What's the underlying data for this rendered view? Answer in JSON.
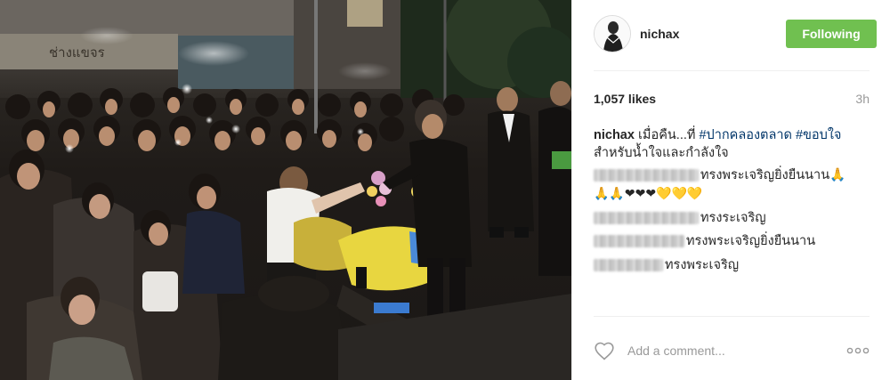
{
  "post": {
    "username": "nichax",
    "follow_label": "Following",
    "likes": "1,057 likes",
    "time": "3h",
    "caption": {
      "user": "nichax",
      "text_before": "เมื่อคืน...ที่",
      "hashtag1": "#ปากคลองตลาด",
      "hashtag2": "#ขอบใจ",
      "text_after": "สำหรับน้ำใจและกำลังใจ"
    },
    "comments": [
      {
        "text": "ทรงพระเจริญยิ่งยืนนาน🙏",
        "extra": "🙏🙏❤❤❤💛💛💛"
      },
      {
        "text": "ทรงระเจริญ"
      },
      {
        "text": "ทรงพระเจริญยิ่งยืนนาน"
      },
      {
        "text": "ทรงพระเจริญ"
      }
    ],
    "add_comment_placeholder": "Add a comment...",
    "icons": {
      "heart": "heart-icon",
      "more": "more-options-icon",
      "avatar": "user-avatar"
    },
    "colors": {
      "follow_bg": "#70c050",
      "hashtag": "#003569",
      "muted": "#999999"
    }
  },
  "photo": {
    "sign_text": "ช่างแขจร"
  }
}
